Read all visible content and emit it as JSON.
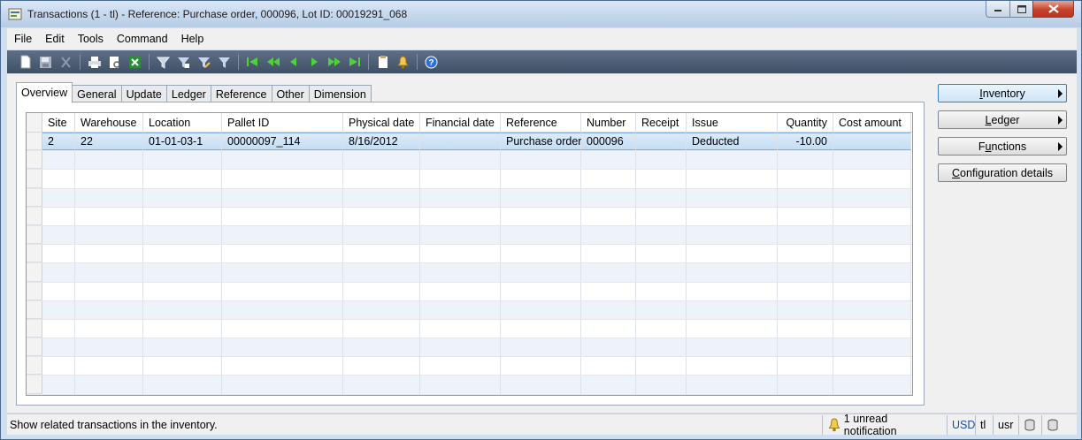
{
  "window": {
    "title": "Transactions (1 - tl) - Reference: Purchase order, 000096, Lot ID: 00019291_068"
  },
  "menu": [
    "File",
    "Edit",
    "Tools",
    "Command",
    "Help"
  ],
  "toolbar_icons": [
    "new-icon",
    "save-icon",
    "delete-icon",
    "|",
    "print-icon",
    "print-preview-icon",
    "export-excel-icon",
    "|",
    "filter-icon",
    "filter-by-selection-icon",
    "advanced-filter-icon",
    "remove-filter-icon",
    "|",
    "first-record-icon",
    "previous-page-icon",
    "previous-record-icon",
    "next-record-icon",
    "next-page-icon",
    "last-record-icon",
    "|",
    "attachments-icon",
    "alerts-icon",
    "|",
    "help-icon"
  ],
  "tabs": [
    "Overview",
    "General",
    "Update",
    "Ledger",
    "Reference",
    "Other",
    "Dimension"
  ],
  "active_tab": "Overview",
  "grid": {
    "columns": [
      "Site",
      "Warehouse",
      "Location",
      "Pallet ID",
      "Physical date",
      "Financial date",
      "Reference",
      "Number",
      "Receipt",
      "Issue",
      "Quantity",
      "Cost amount"
    ],
    "rows": [
      [
        "2",
        "22",
        "01-01-03-1",
        "00000097_114",
        "8/16/2012",
        "",
        "Purchase order",
        "000096",
        "",
        "Deducted",
        "-10.00",
        ""
      ]
    ],
    "empty_rows": 13
  },
  "side_buttons": {
    "inventory": {
      "pre": "",
      "ul": "I",
      "post": "nventory"
    },
    "ledger": {
      "pre": "",
      "ul": "L",
      "post": "edger"
    },
    "functions": {
      "pre": "F",
      "ul": "u",
      "post": "nctions"
    },
    "configuration": {
      "pre": "",
      "ul": "C",
      "post": "onfiguration details"
    }
  },
  "status": {
    "help_text": "Show related transactions in the inventory.",
    "notification": "1 unread notification",
    "currency": "USD",
    "company": "tl",
    "layer": "usr"
  },
  "colors": {
    "accent": "#3c7fb1",
    "selection": "#c4def5",
    "toolbar": "#4a5a72"
  }
}
